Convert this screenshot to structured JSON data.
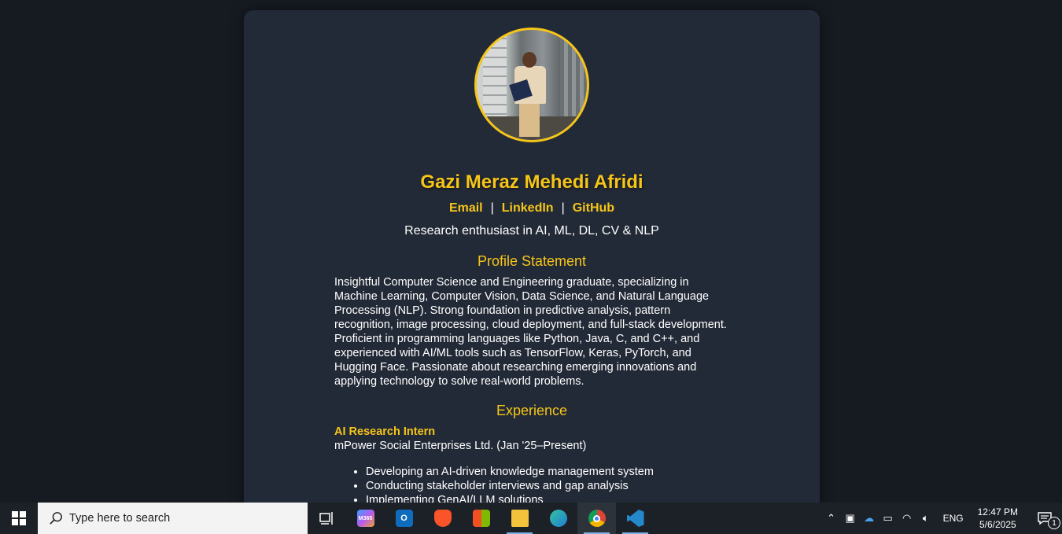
{
  "profile": {
    "name": "Gazi Meraz Mehedi Afridi",
    "links": [
      "Email",
      "LinkedIn",
      "GitHub"
    ],
    "separator": "|",
    "tagline": "Research enthusiast in AI, ML, DL, CV & NLP"
  },
  "profile_statement": {
    "title": "Profile Statement",
    "text": "Insightful Computer Science and Engineering graduate, specializing in Machine Learning, Computer Vision, Data Science, and Natural Language Processing (NLP). Strong foundation in predictive analysis, pattern recognition, image processing, cloud deployment, and full-stack development. Proficient in programming languages like Python, Java, C, and C++, and experienced with AI/ML tools such as TensorFlow, Keras, PyTorch, and Hugging Face. Passionate about researching emerging innovations and applying technology to solve real-world problems."
  },
  "experience": {
    "title": "Experience",
    "role": "AI Research Intern",
    "company": "mPower Social Enterprises Ltd. (Jan '25–Present)",
    "bullets": [
      "Developing an AI-driven knowledge management system",
      "Conducting stakeholder interviews and gap analysis",
      "Implementing GenAI/LLM solutions"
    ]
  },
  "taskbar": {
    "search_placeholder": "Type here to search",
    "apps": [
      {
        "name": "task-view",
        "label": ""
      },
      {
        "name": "m365",
        "label": "M365"
      },
      {
        "name": "outlook",
        "label": "O"
      },
      {
        "name": "brave",
        "label": ""
      },
      {
        "name": "microsoft-store",
        "label": ""
      },
      {
        "name": "file-explorer",
        "label": ""
      },
      {
        "name": "edge",
        "label": ""
      },
      {
        "name": "chrome",
        "label": ""
      },
      {
        "name": "vscode",
        "label": ""
      }
    ],
    "language": "ENG",
    "time": "12:47 PM",
    "date": "5/6/2025",
    "notification_count": "1"
  },
  "colors": {
    "accent": "#f5c518",
    "background": "#161b22",
    "card": "#232a37"
  }
}
